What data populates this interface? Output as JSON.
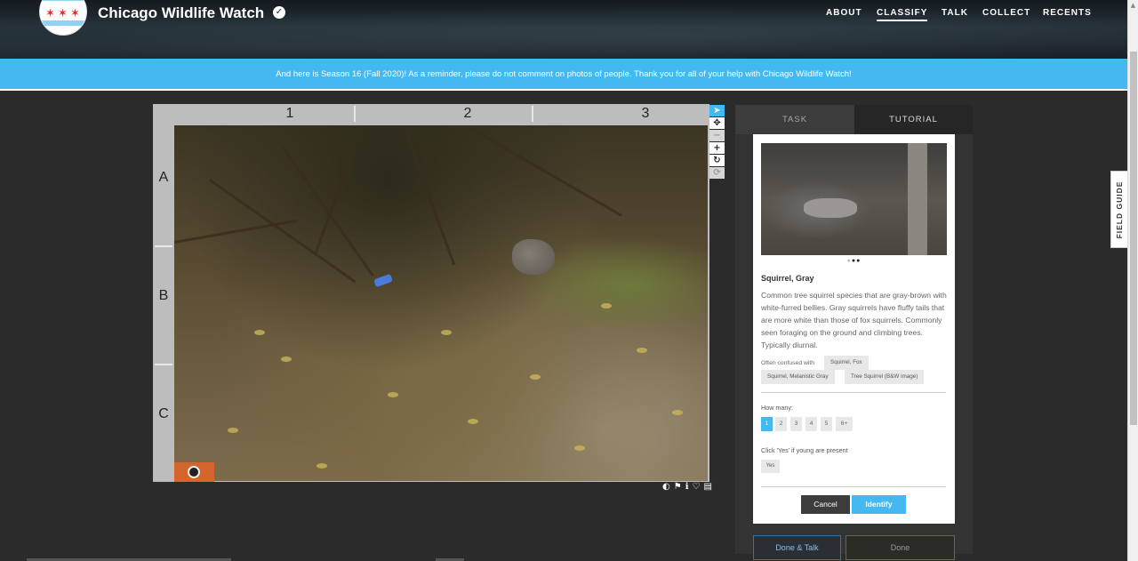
{
  "header": {
    "site_title": "Chicago Wildlife Watch",
    "nav": [
      {
        "label": "ABOUT",
        "active": false
      },
      {
        "label": "CLASSIFY",
        "active": true
      },
      {
        "label": "TALK",
        "active": false
      },
      {
        "label": "COLLECT",
        "active": false
      },
      {
        "label": "RECENTS",
        "active": false
      }
    ]
  },
  "announcement": "And here is Season 16 (Fall 2020)! As a reminder, please do not comment on photos of people. Thank you for all of your help with Chicago Wildlife Watch!",
  "viewer": {
    "columns": [
      "1",
      "2",
      "3"
    ],
    "rows": [
      "A",
      "B",
      "C"
    ],
    "tools": [
      "pointer-icon",
      "pan-icon",
      "zoom-out-icon",
      "zoom-in-icon",
      "rotate-icon",
      "reset-icon"
    ],
    "meta_icons": [
      "invert-icon",
      "flag-icon",
      "info-icon",
      "heart-icon",
      "collect-icon"
    ]
  },
  "task_panel": {
    "tabs": {
      "task": "TASK",
      "tutorial": "TUTORIAL"
    },
    "species_name": "Squirrel, Gray",
    "description": "Common tree squirrel species that are gray-brown with white-furred bellies. Gray squirrels have fluffy tails that are more white than those of fox squirrels. Commonly seen foraging on the ground and climbing trees. Typically diurnal.",
    "confused_label": "Often confused with",
    "confused_with": [
      "Squirrel, Fox",
      "Squirrel, Melanistic Gray",
      "Tree Squirrel (B&W image)"
    ],
    "how_many_label": "How many:",
    "how_many_options": [
      "1",
      "2",
      "3",
      "4",
      "5",
      "6+"
    ],
    "how_many_selected": "1",
    "young_label": "Click 'Yes' if young are present",
    "young_button": "Yes",
    "cancel_label": "Cancel",
    "identify_label": "Identify",
    "done_talk_label": "Done & Talk",
    "done_label": "Done"
  },
  "field_guide_label": "FIELD GUIDE",
  "colors": {
    "accent": "#43b8f1",
    "panel": "#333333",
    "background": "#2b2b2b"
  }
}
